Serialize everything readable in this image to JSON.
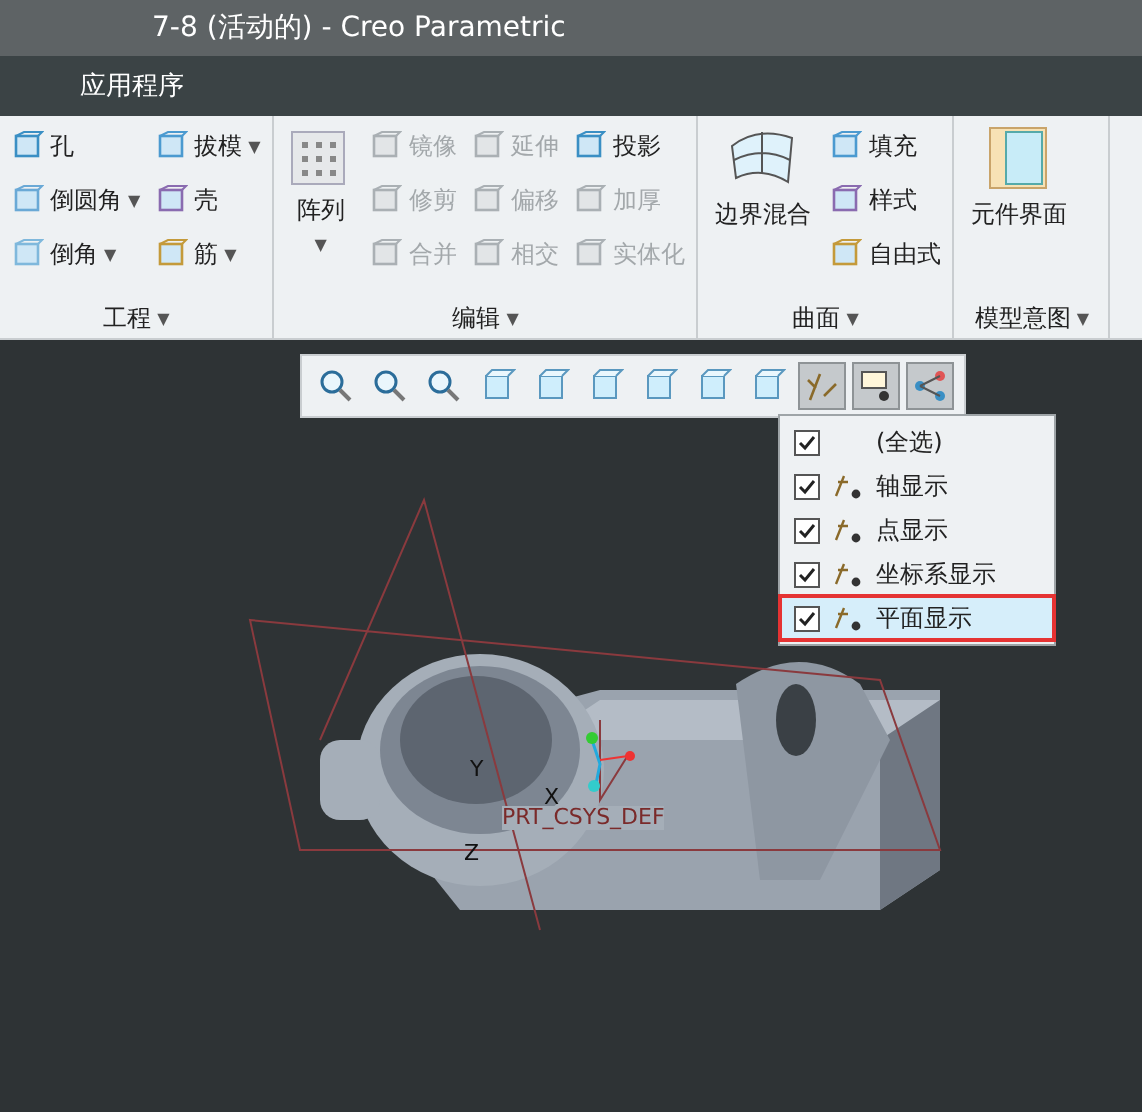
{
  "window": {
    "title": "7-8 (活动的) - Creo Parametric"
  },
  "menu_bar": {
    "items": [
      {
        "label": "应用程序"
      }
    ]
  },
  "ribbon": {
    "groups": [
      {
        "label": "工程",
        "caret": "▼",
        "columns": [
          [
            {
              "label": "孔",
              "disabled": false
            },
            {
              "label": "倒圆角",
              "disabled": false,
              "caret": "▼"
            },
            {
              "label": "倒角",
              "disabled": false,
              "caret": "▼"
            }
          ],
          [
            {
              "label": "拔模",
              "disabled": false,
              "caret": "▼"
            },
            {
              "label": "壳",
              "disabled": false
            },
            {
              "label": "筋",
              "disabled": false,
              "caret": "▼"
            }
          ]
        ]
      },
      {
        "label": "编辑",
        "caret": "▼",
        "large": [
          {
            "label": "阵列",
            "caret": "▼"
          }
        ],
        "columns": [
          [
            {
              "label": "镜像",
              "disabled": true
            },
            {
              "label": "修剪",
              "disabled": true
            },
            {
              "label": "合并",
              "disabled": true
            }
          ],
          [
            {
              "label": "延伸",
              "disabled": true
            },
            {
              "label": "偏移",
              "disabled": true
            },
            {
              "label": "相交",
              "disabled": true
            }
          ],
          [
            {
              "label": "投影",
              "disabled": false
            },
            {
              "label": "加厚",
              "disabled": true
            },
            {
              "label": "实体化",
              "disabled": true
            }
          ]
        ]
      },
      {
        "label": "曲面",
        "caret": "▼",
        "large": [
          {
            "label": "边界混合"
          }
        ],
        "columns": [
          [
            {
              "label": "填充",
              "disabled": false
            },
            {
              "label": "样式",
              "disabled": false
            },
            {
              "label": "自由式",
              "disabled": false
            }
          ]
        ]
      },
      {
        "label": "模型意图",
        "caret": "▼",
        "large": [
          {
            "label": "元件界面"
          }
        ]
      }
    ]
  },
  "view_toolbar": {
    "buttons": [
      {
        "pressed": false
      },
      {
        "pressed": false
      },
      {
        "pressed": false
      },
      {
        "pressed": false
      },
      {
        "pressed": false
      },
      {
        "pressed": false
      },
      {
        "pressed": false
      },
      {
        "pressed": false
      },
      {
        "pressed": false
      },
      {
        "pressed": true
      },
      {
        "pressed": true
      },
      {
        "pressed": true
      }
    ]
  },
  "datum_menu": {
    "items": [
      {
        "label": "(全选)",
        "checked": true,
        "selected": false
      },
      {
        "label": "轴显示",
        "checked": true,
        "selected": false
      },
      {
        "label": "点显示",
        "checked": true,
        "selected": false
      },
      {
        "label": "坐标系显示",
        "checked": true,
        "selected": false
      },
      {
        "label": "平面显示",
        "checked": true,
        "selected": true
      }
    ]
  },
  "model": {
    "axis_labels": [
      "Y",
      "X",
      "Z"
    ],
    "csys_label": "PRT_CSYS_DEF"
  }
}
